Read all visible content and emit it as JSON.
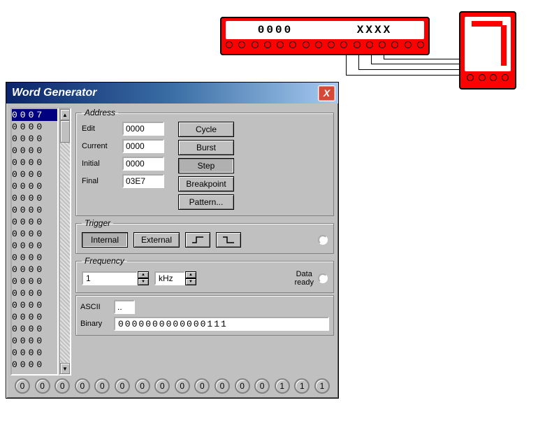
{
  "device_word": {
    "left_text": "0000",
    "right_text": "XXXX",
    "pin_count": 16
  },
  "device_seven": {
    "digit": "7",
    "pin_count": 4
  },
  "dialog": {
    "title": "Word Generator",
    "close_label": "X",
    "wordlist": {
      "selected": "0007",
      "rows": [
        "0000",
        "0000",
        "0000",
        "0000",
        "0000",
        "0000",
        "0000",
        "0000",
        "0000",
        "0000",
        "0000",
        "0000",
        "0000",
        "0000",
        "0000",
        "0000",
        "0000",
        "0000",
        "0000",
        "0000",
        "0000"
      ]
    },
    "address": {
      "legend": "Address",
      "edit_label": "Edit",
      "edit_value": "0000",
      "current_label": "Current",
      "current_value": "0000",
      "initial_label": "Initial",
      "initial_value": "0000",
      "final_label": "Final",
      "final_value": "03E7",
      "cycle_label": "Cycle",
      "burst_label": "Burst",
      "step_label": "Step",
      "breakpoint_label": "Breakpoint",
      "pattern_label": "Pattern..."
    },
    "trigger": {
      "legend": "Trigger",
      "internal_label": "Internal",
      "external_label": "External"
    },
    "frequency": {
      "legend": "Frequency",
      "value": "1",
      "unit": "kHz",
      "data_ready_label": "Data\nready"
    },
    "ascii_label": "ASCII",
    "ascii_value": "..",
    "binary_label": "Binary",
    "binary_value": "0000000000000111",
    "pin_values": [
      "0",
      "0",
      "0",
      "0",
      "0",
      "0",
      "0",
      "0",
      "0",
      "0",
      "0",
      "0",
      "0",
      "1",
      "1",
      "1"
    ]
  }
}
